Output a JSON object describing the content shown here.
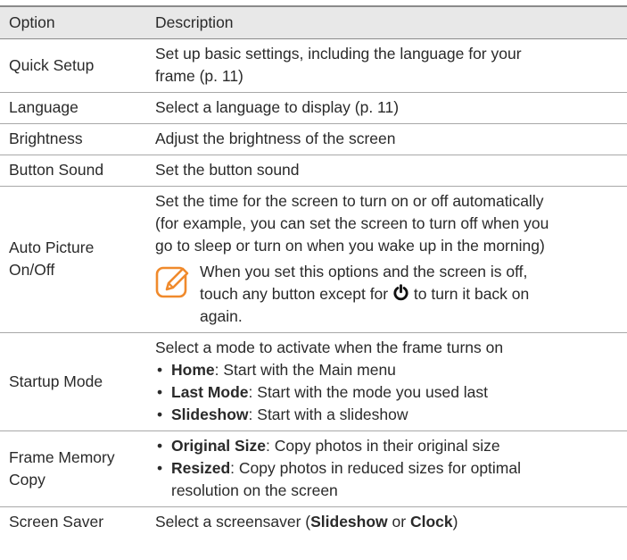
{
  "header": {
    "option": "Option",
    "description": "Description"
  },
  "rows": {
    "quick_setup": {
      "option": "Quick Setup",
      "line1": "Set up basic settings, including the language for your",
      "line2": "frame (p. 11)"
    },
    "language": {
      "option": "Language",
      "description": "Select a language to display (p. 11)"
    },
    "brightness": {
      "option": "Brightness",
      "description": "Adjust the brightness of the screen"
    },
    "button_sound": {
      "option": "Button Sound",
      "description": "Set the button sound"
    },
    "auto_picture": {
      "option_line1": "Auto Picture",
      "option_line2": "On/Off",
      "line1": "Set the time for the screen to turn on or off automatically",
      "line2": "(for example, you can set the screen to turn off when you",
      "line3": "go to sleep or turn on when you wake up in the morning)",
      "note_line1": "When you set this options and the screen is off,",
      "note_line2_before": "touch any button except for",
      "note_line2_after": "to turn it back on",
      "note_line3": "again."
    },
    "startup_mode": {
      "option": "Startup Mode",
      "intro": "Select a mode to activate when the frame turns on",
      "items": [
        {
          "term": "Home",
          "text": ": Start with the Main menu"
        },
        {
          "term": "Last Mode",
          "text": ": Start with the mode you used last"
        },
        {
          "term": "Slideshow",
          "text": ": Start with a slideshow"
        }
      ]
    },
    "frame_memory_copy": {
      "option_line1": "Frame Memory",
      "option_line2": "Copy",
      "item1_term": "Original Size",
      "item1_text": ": Copy photos in their original size",
      "item2_term": "Resized",
      "item2_text_line1": ": Copy photos in reduced sizes for optimal",
      "item2_text_line2": "resolution on the screen"
    },
    "screen_saver": {
      "option": "Screen Saver",
      "text_before": "Select a screensaver (",
      "choice1": "Slideshow",
      "text_or": " or ",
      "choice2": "Clock",
      "text_after": ")"
    }
  },
  "icons": {
    "note": "note-pencil-icon",
    "power": "power-icon"
  },
  "colors": {
    "header_bg": "#e8e8e8",
    "note_icon": "#f08a2c",
    "rule": "#8a8a8a"
  }
}
